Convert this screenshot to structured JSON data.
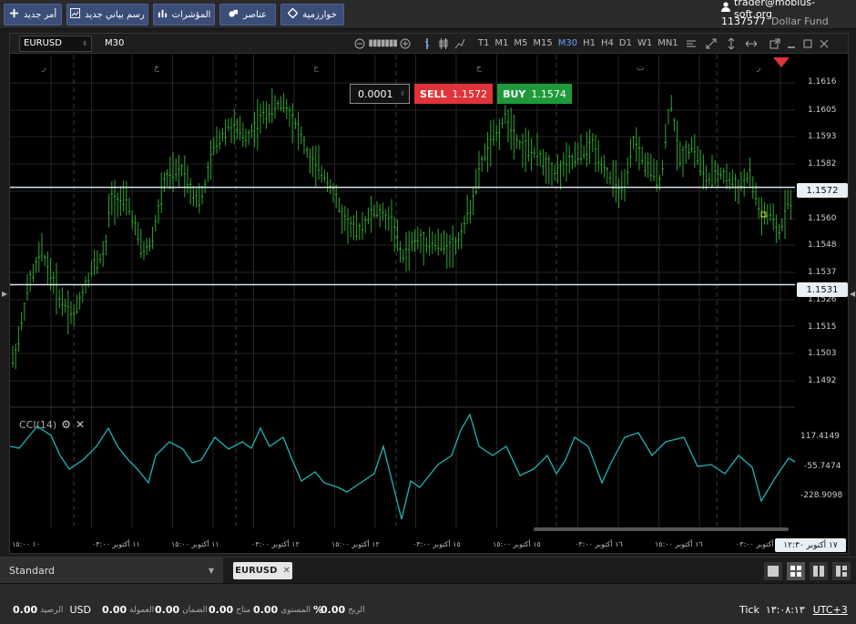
{
  "toolbar": {
    "buttons": [
      {
        "label": "أمر جديد",
        "icon": "plus-icon"
      },
      {
        "label": "رسم بياني جديد",
        "icon": "chart-icon"
      },
      {
        "label": "المؤشرات",
        "icon": "bars-icon"
      },
      {
        "label": "عناصر",
        "icon": "shapes-icon"
      },
      {
        "label": "خوارزمية",
        "icon": "diamond-icon"
      }
    ]
  },
  "account": {
    "email": "trader@mobius-soft.org",
    "id": "1137577",
    "fund": "Dollar Fund"
  },
  "chart": {
    "symbol": "EURUSD",
    "timeframe": "M30",
    "timeframes": [
      "T1",
      "M1",
      "M5",
      "M15",
      "M30",
      "H1",
      "H4",
      "D1",
      "W1",
      "MN1"
    ],
    "active_timeframe": "M30",
    "lot": "0.0001",
    "sell_label": "SELL",
    "sell_price": "1.1572",
    "buy_label": "BUY",
    "buy_price": "1.1574",
    "price_ticks": [
      "1.1616",
      "1.1605",
      "1.1593",
      "1.1582",
      "1.1560",
      "1.1548",
      "1.1537",
      "1.1526",
      "1.1515",
      "1.1503",
      "1.1492"
    ],
    "bid_line": "1.1572",
    "level_line": "1.1531",
    "day_marks": [
      "ر",
      "خ",
      "ج",
      "ح",
      "ث",
      "ر"
    ],
    "time_ticks": [
      "١٠ ١٥:٠٠",
      "١١ أكتوبر ٠٣:٠٠",
      "١١ أكتوبر ١٥:٠٠",
      "١٢ أكتوبر ٠٣:٠٠",
      "١٢ أكتوبر ١٥:٠٠",
      "١٥ أكتوبر ٠٣:٠٠",
      "١٥ أكتوبر ١٥:٠٠",
      "١٦ أكتوبر ٠٣:٠٠",
      "١٦ أكتوبر ١٥:٠٠",
      "١٧ أكتوبر ٠٣:٠٠"
    ],
    "current_time": "١٧ أكتوبر ١٢:٣٠",
    "indicator": {
      "name": "CCI(14)",
      "ticks": [
        "117.4149",
        "-55.7474",
        "-228.9098"
      ]
    }
  },
  "colors": {
    "candles": "#2ea52e",
    "cci": "#1fb5b5",
    "sell": "#e0333a",
    "buy": "#1e9a3a",
    "accent": "#3b4e78"
  },
  "tabs": {
    "workspace": "Standard",
    "chart_tab": "EURUSD"
  },
  "status": {
    "balance_value": "0.00",
    "balance_label": "الرصيد",
    "currency": "USD",
    "commission_value": "0.00",
    "commission_label": "العمولة",
    "margin_value": "0.00",
    "margin_label": "الضمان",
    "available_value": "0.00",
    "available_label": "متاح",
    "level_value": "0.00",
    "level_label": "المستوى",
    "level_unit": "%",
    "profit_value": "0.00",
    "profit_label": "الربح",
    "tick_label": "Tick",
    "clock": "١٣:٠٨:١٣",
    "timezone": "UTC+3"
  }
}
